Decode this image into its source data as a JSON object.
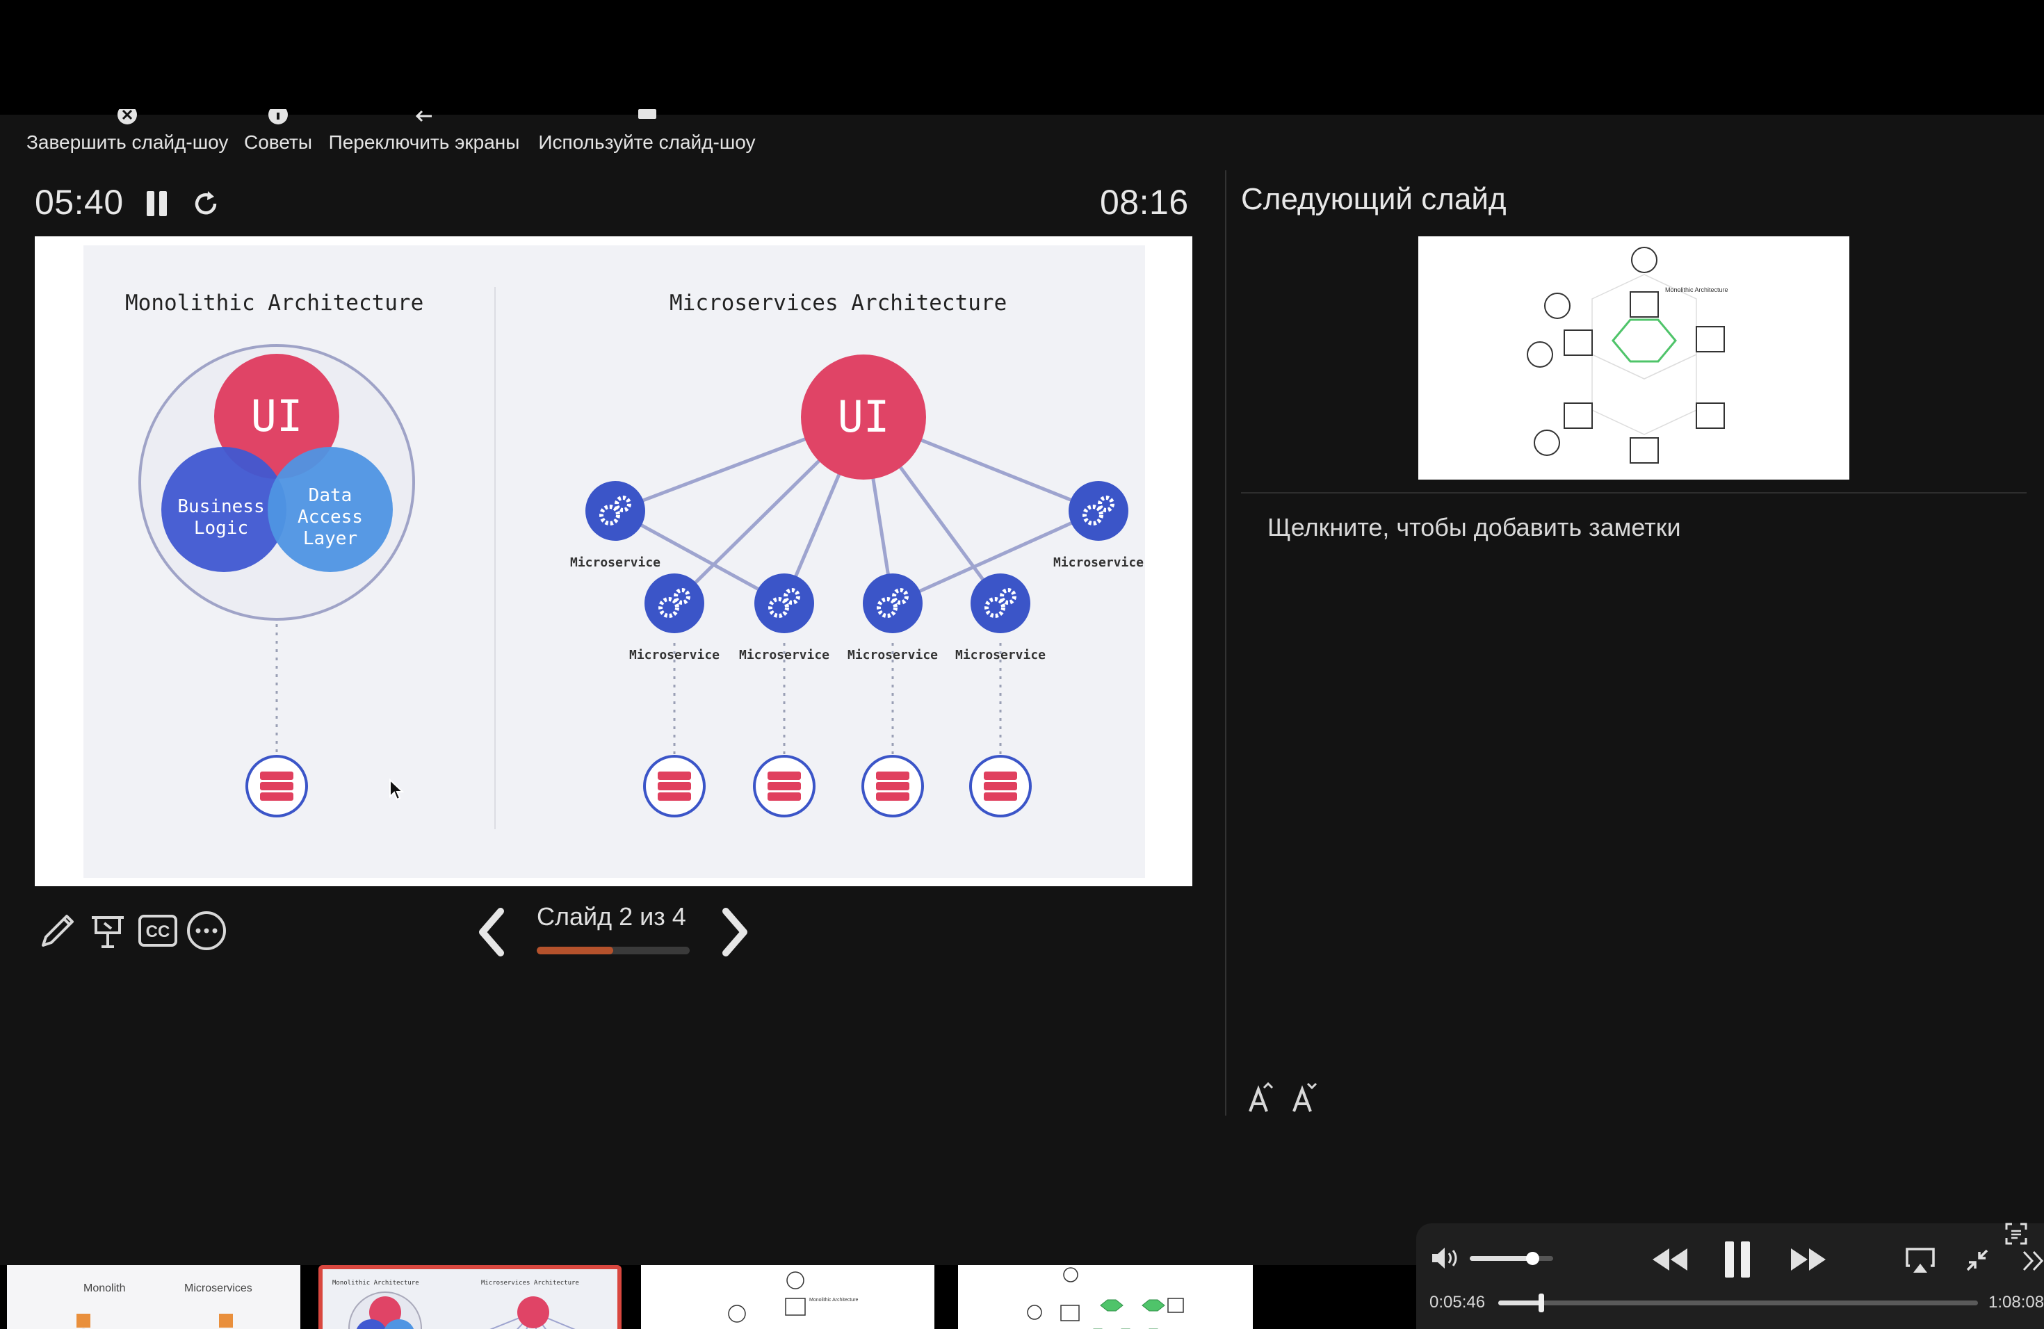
{
  "toolbar": {
    "end_show": "Завершить слайд-шоу",
    "tips": "Советы",
    "switch_screens": "Переключить экраны",
    "use_show": "Используйте слайд-шоу"
  },
  "timers": {
    "elapsed": "05:40",
    "clock": "08:16"
  },
  "slide": {
    "left_title": "Monolithic Architecture",
    "right_title": "Microservices Architecture",
    "ui_label": "UI",
    "business_logic": [
      "Business",
      "Logic"
    ],
    "data_access": [
      "Data",
      "Access",
      "Layer"
    ],
    "microservice_label": "Microservice"
  },
  "next_slide": {
    "heading": "Следующий слайд",
    "thumb_title": "Monolithic Architecture"
  },
  "notes": {
    "placeholder": "Щелкните, чтобы добавить заметки"
  },
  "navigation": {
    "counter": "Слайд 2 из 4",
    "progress_fraction": 0.5,
    "current": 2,
    "total": 4
  },
  "thumbnails": [
    {
      "labels": [
        "Monolith",
        "Microservices"
      ],
      "selected": false
    },
    {
      "labels": [
        "Monolithic Architecture",
        "Microservices Architecture"
      ],
      "selected": true
    },
    {
      "labels": [
        "Monolithic Architecture"
      ],
      "selected": false
    },
    {
      "labels": [],
      "selected": false
    }
  ],
  "player": {
    "current_time": "0:05:46",
    "duration": "1:08:08",
    "volume_fraction": 0.75,
    "playback_fraction": 0.09
  },
  "colors": {
    "ui_red": "#e04466",
    "business_blue": "#4059d1",
    "data_blue": "#4f95e3",
    "service_blue": "#3b55c8",
    "db_red": "#e0405e",
    "progress_orange": "#b5522c",
    "selected_thumb_border": "#d9473f",
    "hex_green": "#4fc46a"
  }
}
